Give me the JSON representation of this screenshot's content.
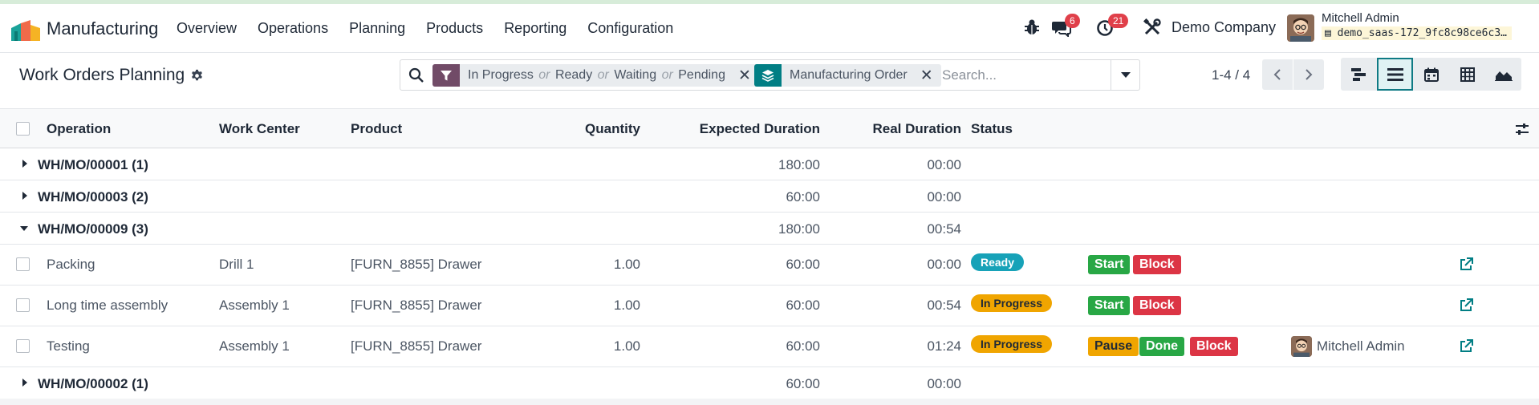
{
  "app": {
    "name": "Manufacturing",
    "menu": [
      "Overview",
      "Operations",
      "Planning",
      "Products",
      "Reporting",
      "Configuration"
    ]
  },
  "systray": {
    "messages_count": "6",
    "activities_count": "21",
    "company": "Demo Company",
    "user_name": "Mitchell Admin",
    "database": "demo_saas-172_9fc8c98ce6c3…"
  },
  "control_panel": {
    "title": "Work Orders Planning",
    "filter_facet": {
      "values": [
        "In Progress",
        "Ready",
        "Waiting",
        "Pending"
      ],
      "separator": "or"
    },
    "group_facet": {
      "value": "Manufacturing Order"
    },
    "search_placeholder": "Search...",
    "pager": "1-4 / 4"
  },
  "colors": {
    "brand": "#714b67",
    "facet_filter_icon": "#714b67",
    "facet_group_icon": "#017e84",
    "status_ready": "#17a2b8",
    "status_in_progress": "#f0a500",
    "button_green": "#28a745",
    "button_red": "#dc3545",
    "link": "#017e84"
  },
  "table": {
    "columns": [
      "Operation",
      "Work Center",
      "Product",
      "Quantity",
      "Expected Duration",
      "Real Duration",
      "Status"
    ],
    "groups": [
      {
        "name": "WH/MO/00001 (1)",
        "expected": "180:00",
        "real": "00:00",
        "expanded": false
      },
      {
        "name": "WH/MO/00003 (2)",
        "expected": "60:00",
        "real": "00:00",
        "expanded": false
      },
      {
        "name": "WH/MO/00009 (3)",
        "expected": "180:00",
        "real": "00:54",
        "expanded": true,
        "records": [
          {
            "operation": "Packing",
            "work_center": "Drill 1",
            "product": "[FURN_8855] Drawer",
            "quantity": "1.00",
            "expected": "60:00",
            "real": "00:00",
            "status": "Ready",
            "buttons": [
              "Start",
              "Block"
            ],
            "user": ""
          },
          {
            "operation": "Long time assembly",
            "work_center": "Assembly 1",
            "product": "[FURN_8855] Drawer",
            "quantity": "1.00",
            "expected": "60:00",
            "real": "00:54",
            "status": "In Progress",
            "buttons": [
              "Start",
              "Block"
            ],
            "user": ""
          },
          {
            "operation": "Testing",
            "work_center": "Assembly 1",
            "product": "[FURN_8855] Drawer",
            "quantity": "1.00",
            "expected": "60:00",
            "real": "01:24",
            "status": "In Progress",
            "buttons": [
              "Pause",
              "Done",
              "Block"
            ],
            "user": "Mitchell Admin"
          }
        ]
      },
      {
        "name": "WH/MO/00002 (1)",
        "expected": "60:00",
        "real": "00:00",
        "expanded": false
      }
    ]
  },
  "icons": {
    "app_logo": "manufacturing-logo-icon",
    "debug": "bug-icon",
    "messages": "chat-icon",
    "activities": "clock-icon",
    "settings": "tools-icon",
    "search": "search-icon",
    "filter": "funnel-icon",
    "group": "layers-icon",
    "optional_columns": "sliders-icon",
    "open_record": "external-link-icon"
  }
}
